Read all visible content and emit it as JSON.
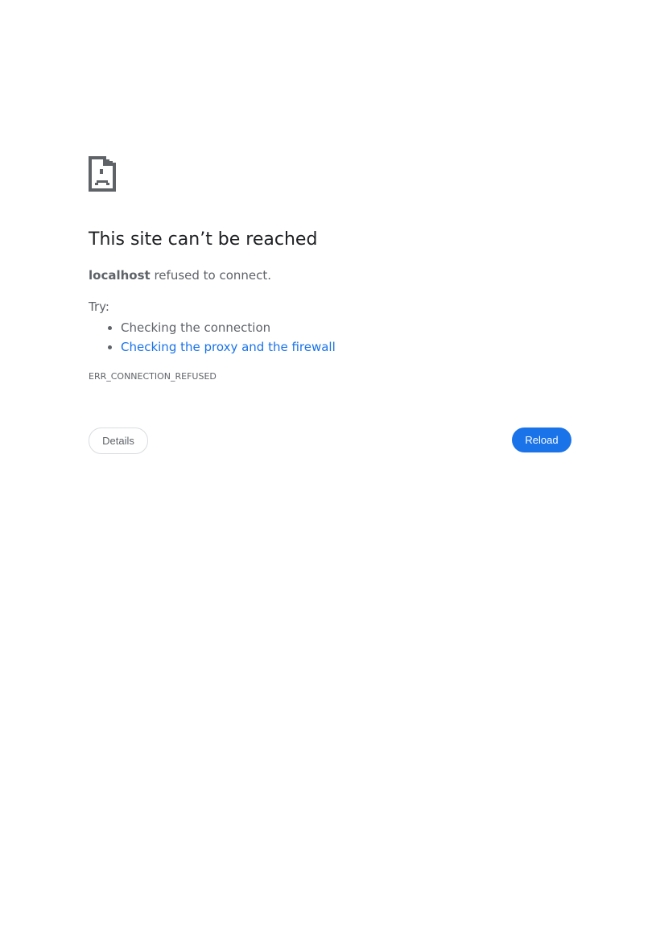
{
  "page": {
    "icon": "sad-page-icon",
    "heading": "This site can’t be reached",
    "summary": {
      "host": "localhost",
      "message": "refused to connect."
    },
    "try_label": "Try:",
    "suggestions": [
      "Checking the connection",
      "Checking the proxy and the firewall"
    ],
    "error_code": "ERR_CONNECTION_REFUSED",
    "buttons": {
      "details_label": "Details",
      "reload_label": "Reload"
    }
  },
  "colors": {
    "text_primary": "#202124",
    "text_secondary": "#5f6368",
    "link": "#1a73e8",
    "button_primary_bg": "#1a73e8"
  }
}
